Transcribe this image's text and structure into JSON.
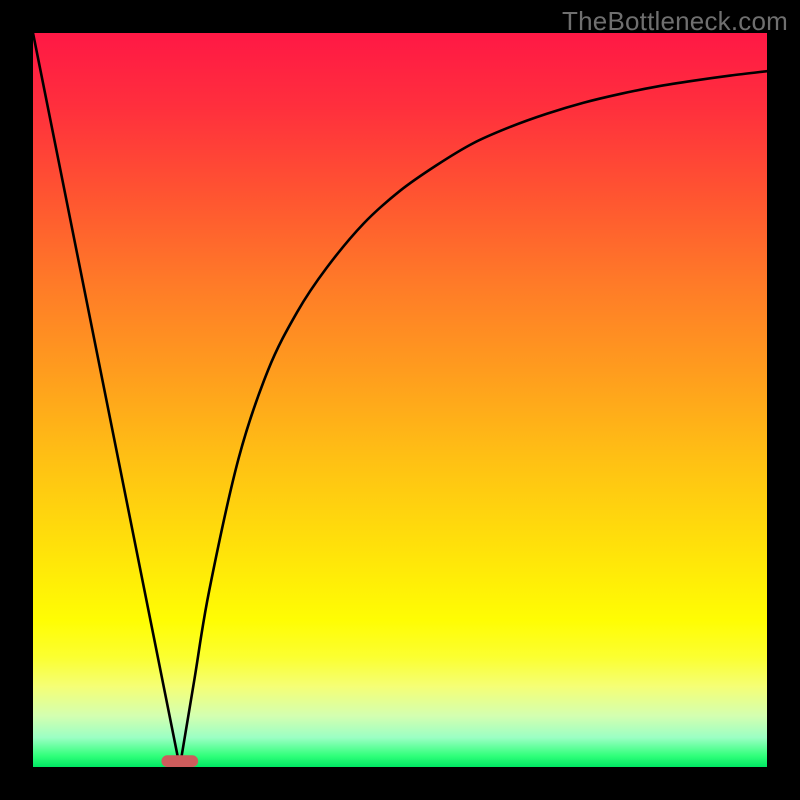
{
  "watermark": "TheBottleneck.com",
  "colors": {
    "frame": "#000000",
    "curve": "#000000",
    "marker": "#cd5c5c",
    "gradient_top": "#ff1845",
    "gradient_bottom": "#00e763"
  },
  "chart_data": {
    "type": "line",
    "title": "",
    "xlabel": "",
    "ylabel": "",
    "xlim": [
      0,
      100
    ],
    "ylim": [
      0,
      100
    ],
    "grid": false,
    "legend": false,
    "marker": {
      "x": 20,
      "y": 0,
      "width": 5,
      "height": 1.6
    },
    "series": [
      {
        "name": "bottleneck-curve",
        "x": [
          0,
          4,
          8,
          12,
          16,
          18,
          20,
          22,
          24,
          28,
          32,
          36,
          40,
          45,
          50,
          55,
          60,
          65,
          70,
          75,
          80,
          85,
          90,
          95,
          100
        ],
        "values": [
          100,
          80,
          60,
          40,
          20,
          10,
          0,
          12,
          24,
          42,
          54,
          62,
          68,
          74,
          78.5,
          82,
          85,
          87.2,
          89,
          90.5,
          91.7,
          92.7,
          93.5,
          94.2,
          94.8
        ]
      }
    ]
  }
}
